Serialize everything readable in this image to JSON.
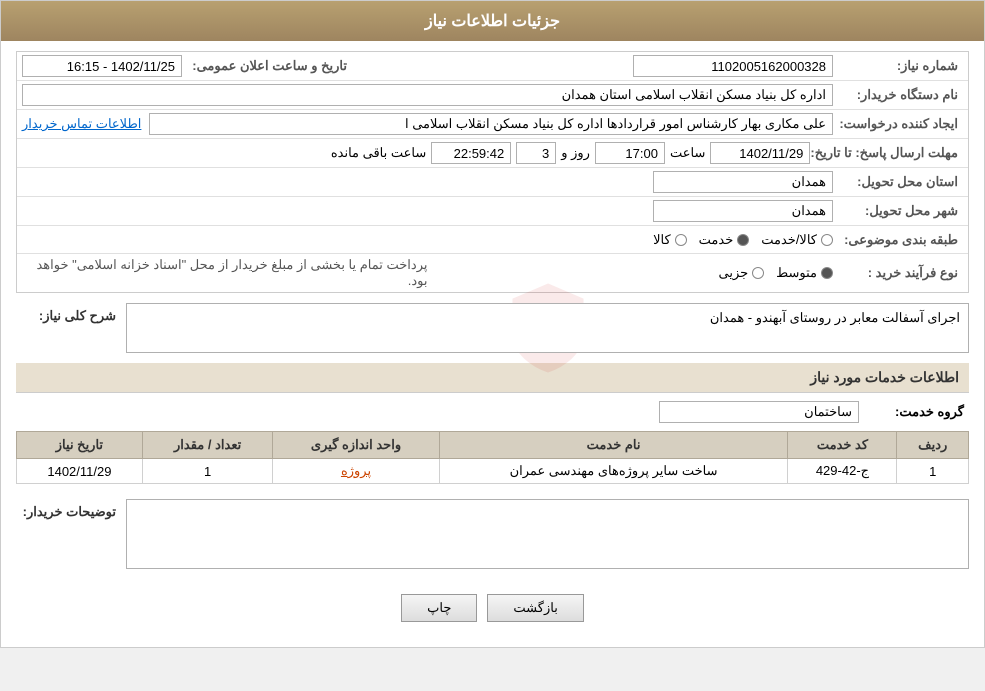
{
  "header": {
    "title": "جزئیات اطلاعات نیاز"
  },
  "fields": {
    "shomara_niaz_label": "شماره نیاز:",
    "shomara_niaz_value": "1102005162000328",
    "nam_dastgah_label": "نام دستگاه خریدار:",
    "nam_dastgah_value": "اداره کل بنیاد مسکن انقلاب اسلامی استان همدان",
    "ijad_konande_label": "ایجاد کننده درخواست:",
    "ijad_konande_value": "علی مکاری بهار کارشناس امور قراردادها اداره کل بنیاد مسکن انقلاب اسلامی ا",
    "ijad_konande_link": "اطلاعات تماس خریدار",
    "tarikh_label": "تاریخ و ساعت اعلان عمومی:",
    "tarikh_value": "1402/11/25 - 16:15",
    "mohlat_label": "مهلت ارسال پاسخ: تا تاریخ:",
    "mohlat_date": "1402/11/29",
    "mohlat_time": "17:00",
    "mohlat_days": "3",
    "mohlat_remaining": "22:59:42",
    "ostan_label": "استان محل تحویل:",
    "ostan_value": "همدان",
    "shahr_label": "شهر محل تحویل:",
    "shahr_value": "همدان",
    "tabagheh_label": "طبقه بندی موضوعی:",
    "tabagheh_options": [
      "کالا",
      "خدمت",
      "کالا/خدمت"
    ],
    "tabagheh_selected": "خدمت",
    "noea_label": "نوع فرآیند خرید :",
    "noea_options": [
      "جزیی",
      "متوسط"
    ],
    "noea_selected": "متوسط",
    "noea_description": "پرداخت تمام یا بخشی از مبلغ خریدار از محل \"اسناد خزانه اسلامی\" خواهد بود.",
    "sharh_label": "شرح کلی نیاز:",
    "sharh_value": "اجرای آسفالت معابر در روستای آبهندو - همدان",
    "group_label": "گروه خدمت:",
    "group_value": "ساختمان",
    "table": {
      "headers": [
        "ردیف",
        "کد خدمت",
        "نام خدمت",
        "واحد اندازه گیری",
        "تعداد / مقدار",
        "تاریخ نیاز"
      ],
      "rows": [
        {
          "radif": "1",
          "kod": "ج-42-429",
          "nam": "ساخت سایر پروژه‌های مهندسی عمران",
          "vahed": "پروژه",
          "tedad": "1",
          "tarikh": "1402/11/29"
        }
      ]
    },
    "tavsiyeh_label": "توضیحات خریدار:",
    "tavsiyeh_value": ""
  },
  "buttons": {
    "print_label": "چاپ",
    "back_label": "بازگشت"
  },
  "misc": {
    "saaat_baqi": "ساعت باقی مانده",
    "roz_o": "روز و"
  }
}
